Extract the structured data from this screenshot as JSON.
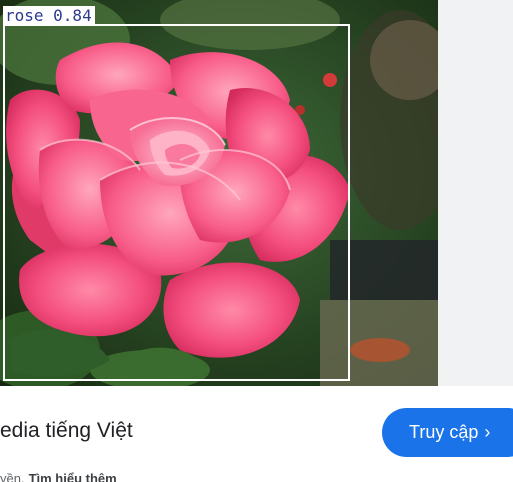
{
  "detection": {
    "label": "rose 0.84",
    "class": "rose",
    "confidence": 0.84
  },
  "footer": {
    "site_title": "edia tiếng Việt",
    "note_prefix": "yền.",
    "note_link": "Tìm hiểu thêm",
    "visit_button": "Truy cập",
    "visit_icon": "chevron-right-icon"
  },
  "colors": {
    "box": "#ffffff",
    "label_text": "#2c3a8f",
    "button": "#1a73e8",
    "side_panel": "#f0f2f3"
  }
}
